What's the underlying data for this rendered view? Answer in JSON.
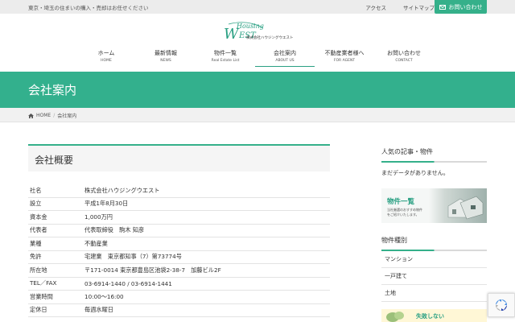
{
  "topbar": {
    "tagline": "東京・埼玉の住まいの購入・売却はお任せください",
    "links": [
      "アクセス",
      "サイトマップ"
    ],
    "contact_button": "お問い合わせ"
  },
  "logo": {
    "script": "Housing WEST",
    "sub": "株式会社ハウジングウエスト"
  },
  "nav": [
    {
      "jp": "ホーム",
      "en": "HOME"
    },
    {
      "jp": "最新情報",
      "en": "NEWS"
    },
    {
      "jp": "物件一覧",
      "en": "Real Estate List"
    },
    {
      "jp": "会社案内",
      "en": "ABOUT US"
    },
    {
      "jp": "不動産業者様へ",
      "en": "FOR AGENT"
    },
    {
      "jp": "お問い合わせ",
      "en": "CONTACT"
    }
  ],
  "banner": {
    "title": "会社案内"
  },
  "breadcrumb": {
    "home": "HOME",
    "separator": "/",
    "current": "会社案内"
  },
  "section": {
    "title": "会社概要"
  },
  "company_info": [
    {
      "k": "社名",
      "v": "株式会社ハウジングウエスト"
    },
    {
      "k": "設立",
      "v": "平成1年8月30日"
    },
    {
      "k": "資本金",
      "v": "1,000万円"
    },
    {
      "k": "代表者",
      "v": "代表取締役　駒木 知彦"
    },
    {
      "k": "業種",
      "v": "不動産業"
    },
    {
      "k": "免許",
      "v": "宅建業　東京都知事（7）第73774号"
    },
    {
      "k": "所在地",
      "v": "〒171-0014 東京都豊島区池袋2-38-7　加藤ビル2F"
    },
    {
      "k": "TEL／FAX",
      "v": "03-6914-1440 / 03-6914-1441"
    },
    {
      "k": "営業時間",
      "v": "10:00〜16:00"
    },
    {
      "k": "定休日",
      "v": "毎週水曜日"
    }
  ],
  "sidebar": {
    "popular_title": "人気の記事・物件",
    "popular_empty": "まだデータがありません。",
    "banner_title": "物件一覧",
    "banner_sub": "当社厳選のおすすめ物件をご紹介いたします。",
    "category_title": "物件種別",
    "categories": [
      "マンション",
      "一戸建て",
      "土地"
    ],
    "bottom_banner": "失敗しない"
  },
  "colors": {
    "accent": "#35b08a"
  }
}
